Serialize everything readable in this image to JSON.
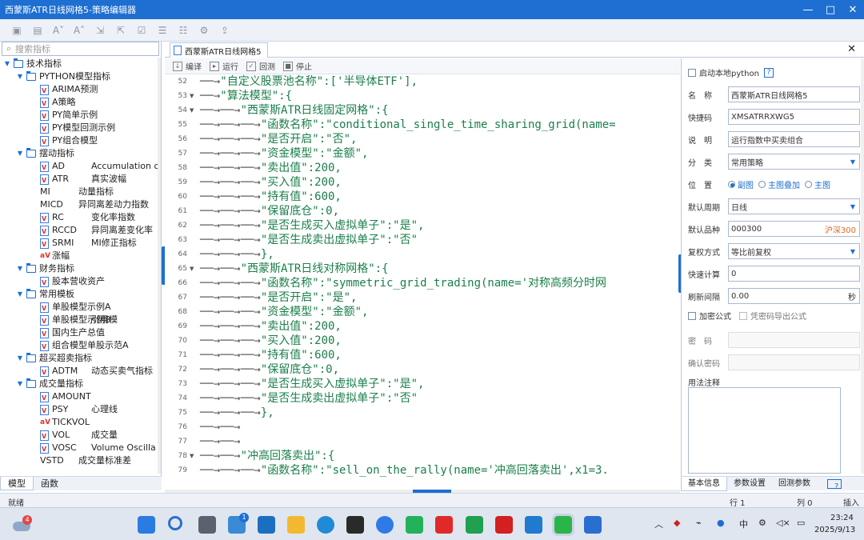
{
  "window": {
    "title": "西蒙斯ATR日线网格5-策略编辑器",
    "min": "—",
    "max": "□",
    "close": "✕"
  },
  "toolbar": {
    "icons": [
      "save-icon",
      "save-all-icon",
      "font-smaller-icon",
      "font-larger-icon",
      "import-icon",
      "export-icon",
      "check-icon",
      "list-icon",
      "list-edit-icon",
      "settings-icon",
      "export-file-icon"
    ]
  },
  "search": {
    "placeholder": "搜索指标"
  },
  "tree": [
    {
      "level": 0,
      "type": "folder",
      "label": "技术指标"
    },
    {
      "level": 1,
      "type": "folder",
      "label": "PYTHON模型指标"
    },
    {
      "level": 2,
      "type": "file",
      "label": "ARIMA预测"
    },
    {
      "level": 2,
      "type": "file",
      "label": "A策略"
    },
    {
      "level": 2,
      "type": "file",
      "label": "PY简单示例"
    },
    {
      "level": 2,
      "type": "file",
      "label": "PY模型回测示例"
    },
    {
      "level": 2,
      "type": "file",
      "label": "PY组合模型"
    },
    {
      "level": 1,
      "type": "folder",
      "label": "摆动指标"
    },
    {
      "level": 2,
      "type": "file",
      "label": "AD",
      "desc": "Accumulation or"
    },
    {
      "level": 2,
      "type": "file",
      "label": "ATR",
      "desc": "真实波幅"
    },
    {
      "level": 2,
      "type": "plain",
      "label": "MI",
      "desc": "动量指标"
    },
    {
      "level": 2,
      "type": "plain",
      "label": "MICD",
      "desc": "异同离差动力指数"
    },
    {
      "level": 2,
      "type": "file",
      "label": "RC",
      "desc": "变化率指数"
    },
    {
      "level": 2,
      "type": "file",
      "label": "RCCD",
      "desc": "异同离差变化率"
    },
    {
      "level": 2,
      "type": "file",
      "label": "SRMI",
      "desc": "MI修正指标"
    },
    {
      "level": 2,
      "type": "fx",
      "label": "涨幅"
    },
    {
      "level": 1,
      "type": "folder",
      "label": "财务指标"
    },
    {
      "level": 2,
      "type": "file",
      "label": "股本营收资产"
    },
    {
      "level": 1,
      "type": "folder",
      "label": "常用模板"
    },
    {
      "level": 2,
      "type": "file",
      "label": "单股模型示例A"
    },
    {
      "level": 2,
      "type": "file",
      "label": "单股模型示例B",
      "desc": "引用模"
    },
    {
      "level": 2,
      "type": "file",
      "label": "国内生产总值"
    },
    {
      "level": 2,
      "type": "file",
      "label": "组合模型单股示范A"
    },
    {
      "level": 1,
      "type": "folder",
      "label": "超买超卖指标"
    },
    {
      "level": 2,
      "type": "file",
      "label": "ADTM",
      "desc": "动态买卖气指标"
    },
    {
      "level": 1,
      "type": "folder",
      "label": "成交量指标"
    },
    {
      "level": 2,
      "type": "file",
      "label": "AMOUNT"
    },
    {
      "level": 2,
      "type": "file",
      "label": "PSY",
      "desc": "心理线"
    },
    {
      "level": 2,
      "type": "fx",
      "label": "TICKVOL"
    },
    {
      "level": 2,
      "type": "file",
      "label": "VOL",
      "desc": "成交量"
    },
    {
      "level": 2,
      "type": "file",
      "label": "VOSC",
      "desc": "Volume Oscilla"
    },
    {
      "level": 2,
      "type": "plain",
      "label": "VSTD",
      "desc": "成交量标准差"
    }
  ],
  "left_tabs": [
    "模型",
    "函数"
  ],
  "doc_tab": {
    "label": "西蒙斯ATR日线网格5",
    "close": "✕"
  },
  "editor_toolbar": [
    {
      "label": "编译"
    },
    {
      "label": "运行"
    },
    {
      "label": "回测"
    },
    {
      "label": "停止"
    }
  ],
  "code_lines": [
    {
      "n": "52",
      "fold": "",
      "indent": 1,
      "text": "\"自定义股票池名称\":['半导体ETF'],"
    },
    {
      "n": "53",
      "fold": "▼",
      "indent": 1,
      "text": "\"算法模型\":{"
    },
    {
      "n": "54",
      "fold": "▼",
      "indent": 2,
      "text": "\"西蒙斯ATR日线固定网格\":{"
    },
    {
      "n": "55",
      "fold": "",
      "indent": 3,
      "text": "\"函数名称\":\"conditional_single_time_sharing_grid(name="
    },
    {
      "n": "56",
      "fold": "",
      "indent": 3,
      "text": "\"是否开启\":\"否\","
    },
    {
      "n": "57",
      "fold": "",
      "indent": 3,
      "text": "\"资金模型\":\"金额\","
    },
    {
      "n": "58",
      "fold": "",
      "indent": 3,
      "text": "\"卖出值\":200,"
    },
    {
      "n": "59",
      "fold": "",
      "indent": 3,
      "text": "\"买入值\":200,"
    },
    {
      "n": "60",
      "fold": "",
      "indent": 3,
      "text": "\"持有值\":600,"
    },
    {
      "n": "61",
      "fold": "",
      "indent": 3,
      "text": "\"保留底仓\":0,"
    },
    {
      "n": "62",
      "fold": "",
      "indent": 3,
      "text": "\"是否生成买入虚拟单子\":\"是\","
    },
    {
      "n": "63",
      "fold": "",
      "indent": 3,
      "text": "\"是否生成卖出虚拟单子\":\"否\""
    },
    {
      "n": "64",
      "fold": "",
      "indent": 3,
      "text": "},"
    },
    {
      "n": "65",
      "fold": "▼",
      "indent": 2,
      "text": "\"西蒙斯ATR日线对称网格\":{"
    },
    {
      "n": "66",
      "fold": "",
      "indent": 3,
      "text": "\"函数名称\":\"symmetric_grid_trading(name='对称高频分时网"
    },
    {
      "n": "67",
      "fold": "",
      "indent": 3,
      "text": "\"是否开启\":\"是\","
    },
    {
      "n": "68",
      "fold": "",
      "indent": 3,
      "text": "\"资金模型\":\"金额\","
    },
    {
      "n": "69",
      "fold": "",
      "indent": 3,
      "text": "\"卖出值\":200,"
    },
    {
      "n": "70",
      "fold": "",
      "indent": 3,
      "text": "\"买入值\":200,"
    },
    {
      "n": "71",
      "fold": "",
      "indent": 3,
      "text": "\"持有值\":600,"
    },
    {
      "n": "72",
      "fold": "",
      "indent": 3,
      "text": "\"保留底仓\":0,"
    },
    {
      "n": "73",
      "fold": "",
      "indent": 3,
      "text": "\"是否生成买入虚拟单子\":\"是\","
    },
    {
      "n": "74",
      "fold": "",
      "indent": 3,
      "text": "\"是否生成卖出虚拟单子\":\"否\""
    },
    {
      "n": "75",
      "fold": "",
      "indent": 3,
      "text": "},"
    },
    {
      "n": "76",
      "fold": "",
      "indent": 2,
      "text": ""
    },
    {
      "n": "77",
      "fold": "",
      "indent": 2,
      "text": ""
    },
    {
      "n": "78",
      "fold": "▼",
      "indent": 2,
      "text": "\"冲高回落卖出\":{"
    },
    {
      "n": "79",
      "fold": "",
      "indent": 3,
      "text": "\"函数名称\":\"sell_on_the_rally(name='冲高回落卖出',x1=3."
    }
  ],
  "props": {
    "local_python": "启动本地python",
    "help": "?",
    "name_label": "名　称",
    "name_value": "西蒙斯ATR日线网格5",
    "code_label": "快捷码",
    "code_value": "XMSATRRXWG5",
    "desc_label": "说　明",
    "desc_value": "运行指数中买卖组合",
    "cat_label": "分　类",
    "cat_value": "常用策略",
    "pos_label": "位　置",
    "pos_options": [
      "副图",
      "主图叠加",
      "主图"
    ],
    "period_label": "默认周期",
    "period_value": "日线",
    "variety_label": "默认品种",
    "variety_value": "000300",
    "variety_name": "沪深300",
    "rights_label": "复权方式",
    "rights_value": "等比前复权",
    "fast_label": "快速计算",
    "fast_value": "0",
    "refresh_label": "刷新间隔",
    "refresh_value": "0.00",
    "refresh_unit": "秒",
    "encrypt_label": "加密公式",
    "export_label": "凭密码导出公式",
    "pwd_label": "密　码",
    "pwd2_label": "确认密码",
    "note_label": "用法注释"
  },
  "right_tabs": [
    "基本信息",
    "参数设置",
    "回测参数"
  ],
  "status": {
    "left": "就绪",
    "row": "行 1",
    "col": "列 0",
    "mode": "插入"
  },
  "taskbar": {
    "badge": "4",
    "store_badge": "1",
    "ime": "中",
    "time": "23:24",
    "date": "2025/9/13"
  },
  "colors": {
    "accent": "#1e6fd1",
    "code": "#1a7f4a",
    "red": "#e03030"
  }
}
